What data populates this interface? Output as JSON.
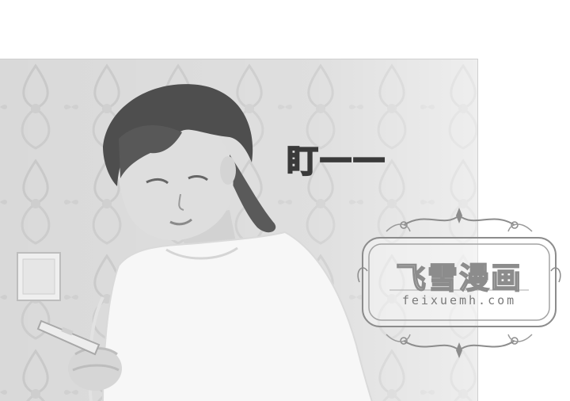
{
  "panel": {
    "sound_effect": "盯一一"
  },
  "watermark": {
    "title": "飞雪漫画",
    "url": "feixuemh.com"
  },
  "colors": {
    "background": "#ffffff",
    "photo_tone": "#dcdcdc",
    "watermark_stroke": "#8c8c8c"
  }
}
